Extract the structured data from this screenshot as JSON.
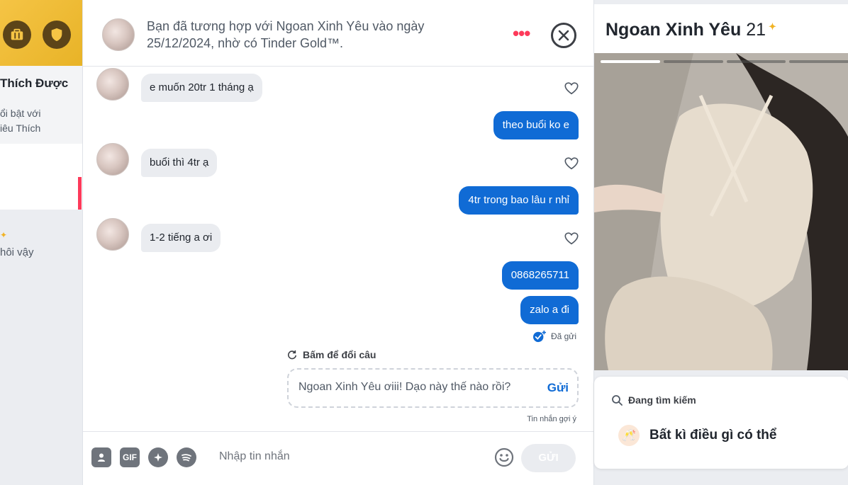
{
  "sidebar": {
    "top_icons": [
      "briefcase-icon",
      "shield-icon"
    ],
    "likes_title": "Thích Được",
    "likes_subtitle_1": "ổi bật với",
    "likes_subtitle_2": "iêu Thích",
    "match_star": "✦",
    "match_preview": "hôi vậy"
  },
  "header": {
    "match_notice": "Bạn đã tương hợp với Ngoan Xinh Yêu vào ngày 25/12/2024, nhờ có Tinder Gold™.",
    "more_label": "•••"
  },
  "messages": [
    {
      "direction": "in",
      "text": "e muốn 20tr 1 tháng ạ"
    },
    {
      "direction": "out",
      "text": "theo buổi ko e"
    },
    {
      "direction": "in",
      "text": "buổi thì 4tr ạ"
    },
    {
      "direction": "out",
      "text": "4tr trong bao lâu r nhỉ"
    },
    {
      "direction": "in",
      "text": "1-2 tiếng a ơi"
    },
    {
      "direction": "out",
      "text": "0868265711"
    },
    {
      "direction": "out",
      "text": "zalo a đi"
    }
  ],
  "sent_status": "Đã gửi",
  "suggestion": {
    "label": "Bấm để đổi câu",
    "text": "Ngoan Xinh Yêu ơiii! Dạo này thế nào rồi?",
    "send_label": "Gửi",
    "note": "Tin nhắn gợi ý"
  },
  "composer": {
    "gif_label": "GIF",
    "placeholder": "Nhập tin nhắn",
    "send_label": "GỬI"
  },
  "profile": {
    "name": "Ngoan Xinh Yêu",
    "age": "21",
    "photo_count": 4,
    "active_photo_index": 0,
    "looking_for_label": "Đang tìm kiếm",
    "looking_for_value": "Bất kì điều gì có thể"
  },
  "colors": {
    "brand_red": "#fd3a5a",
    "message_blue": "#106bd5",
    "gold": "#f1b324"
  }
}
